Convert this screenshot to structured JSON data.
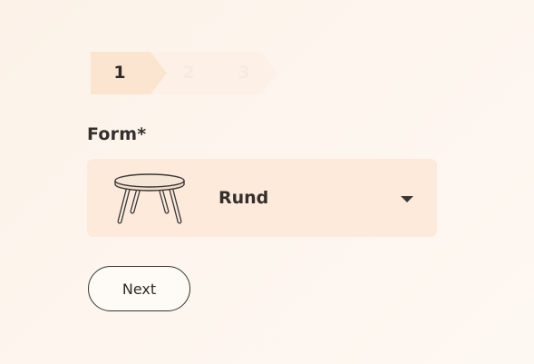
{
  "stepper": {
    "steps": [
      {
        "label": "1",
        "active": true
      },
      {
        "label": "2",
        "active": false
      },
      {
        "label": "3",
        "active": false
      }
    ]
  },
  "form": {
    "field_label": "Form*",
    "select": {
      "selected_value": "Rund",
      "icon": "round-table-icon"
    },
    "next_label": "Next"
  },
  "colors": {
    "background": "#fdf5ee",
    "step_active": "#fbe4d0",
    "step_inactive": "#fdf1e7",
    "select_background": "#fdeadb",
    "text": "#2e2a27"
  }
}
